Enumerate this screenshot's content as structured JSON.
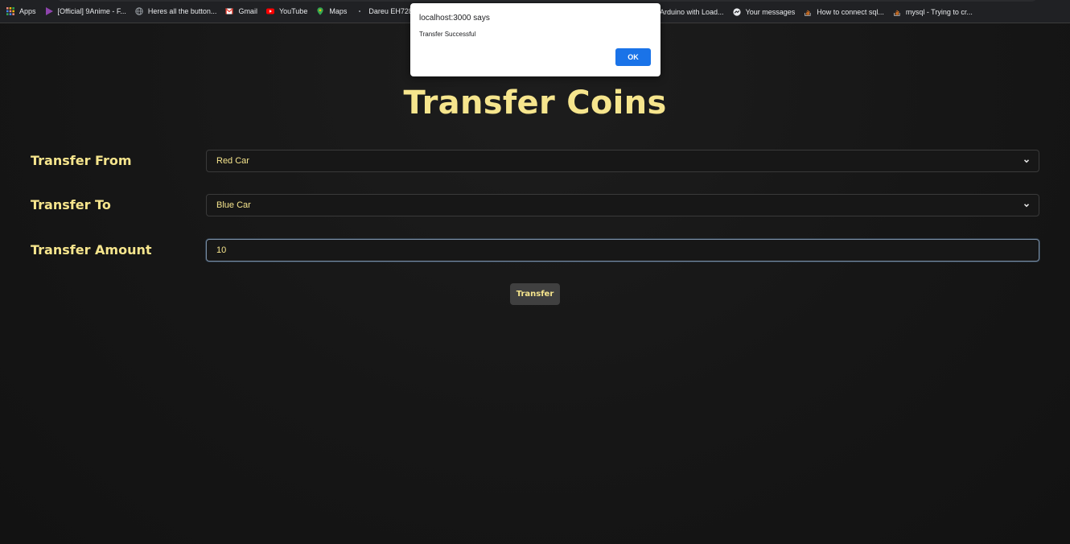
{
  "bookmarks": {
    "left": [
      {
        "label": "Apps",
        "icon": "apps-grid-icon",
        "color": "#f28b82"
      },
      {
        "label": "[Official] 9Anime - F...",
        "icon": "play-icon",
        "color": "#8e44ad"
      },
      {
        "label": "Heres all the button...",
        "icon": "globe-icon",
        "color": "#9aa0a6"
      },
      {
        "label": "Gmail",
        "icon": "gmail-icon",
        "color": "#ea4335"
      },
      {
        "label": "YouTube",
        "icon": "youtube-icon",
        "color": "#ff0000"
      },
      {
        "label": "Maps",
        "icon": "maps-pin-icon",
        "color": "#34a853"
      },
      {
        "label": "Dareu EH728 Pro -",
        "icon": "dot-icon",
        "color": "#9aa0a6"
      }
    ],
    "right": [
      {
        "label": "Arduino with Load...",
        "icon": "",
        "color": ""
      },
      {
        "label": "Your messages",
        "icon": "messenger-icon",
        "color": "#e8eaed"
      },
      {
        "label": "How to connect sql...",
        "icon": "stackoverflow-icon",
        "color": "#f48024"
      },
      {
        "label": "mysql - Trying to cr...",
        "icon": "stackoverflow-icon",
        "color": "#f48024"
      }
    ]
  },
  "page": {
    "title": "Transfer Coins",
    "from": {
      "label": "Transfer From",
      "value": "Red Car"
    },
    "to": {
      "label": "Transfer To",
      "value": "Blue Car"
    },
    "amount": {
      "label": "Transfer Amount",
      "value": "10"
    },
    "submit_label": "Transfer"
  },
  "dialog": {
    "title": "localhost:3000 says",
    "message": "Transfer Successful",
    "ok_label": "OK"
  },
  "colors": {
    "accent": "#f6e58d",
    "background": "#151515",
    "dialog_button": "#1a73e8"
  }
}
